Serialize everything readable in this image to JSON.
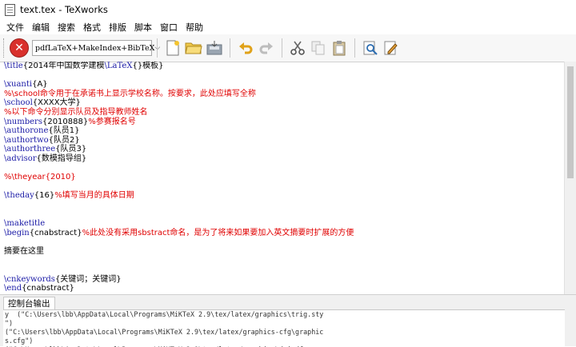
{
  "window": {
    "title": "text.tex - TeXworks"
  },
  "menu": [
    "文件",
    "编辑",
    "搜索",
    "格式",
    "排版",
    "脚本",
    "窗口",
    "帮助"
  ],
  "toolbar": {
    "typeset_engine": "pdfLaTeX+MakeIndex+BibTeX",
    "icons": [
      "stop-typeset-icon",
      "new-file-icon",
      "open-folder-icon",
      "save-icon",
      "undo-icon",
      "redo-icon",
      "cut-icon",
      "copy-icon",
      "paste-icon",
      "search-icon",
      "preferences-icon"
    ]
  },
  "editor": {
    "lines": [
      [
        {
          "t": "\\title",
          "c": "cmd"
        },
        {
          "t": "{2014年中国数学建模",
          "c": "plain"
        },
        {
          "t": "\\LaTeX",
          "c": "cmd"
        },
        {
          "t": "{}模板}",
          "c": "plain"
        }
      ],
      [],
      [
        {
          "t": "\\xuanti",
          "c": "cmd"
        },
        {
          "t": "{A}",
          "c": "plain"
        }
      ],
      [
        {
          "t": "%\\school命令用于在承诺书上显示学校名称。按要求，此处应填写全称",
          "c": "comment"
        }
      ],
      [
        {
          "t": "\\school",
          "c": "cmd"
        },
        {
          "t": "{XXXX大学}",
          "c": "plain"
        }
      ],
      [
        {
          "t": "%以下命令分别显示队员及指导教师姓名",
          "c": "comment"
        }
      ],
      [
        {
          "t": "\\numbers",
          "c": "cmd"
        },
        {
          "t": "{2010888}",
          "c": "plain"
        },
        {
          "t": "%参赛报名号",
          "c": "comment"
        }
      ],
      [
        {
          "t": "\\authorone",
          "c": "cmd"
        },
        {
          "t": "{队员1}",
          "c": "plain"
        }
      ],
      [
        {
          "t": "\\authortwo",
          "c": "cmd"
        },
        {
          "t": "{队员2}",
          "c": "plain"
        }
      ],
      [
        {
          "t": "\\authorthree",
          "c": "cmd"
        },
        {
          "t": "{队员3}",
          "c": "plain"
        }
      ],
      [
        {
          "t": "\\advisor",
          "c": "cmd"
        },
        {
          "t": "{数模指导组}",
          "c": "plain"
        }
      ],
      [],
      [
        {
          "t": "%\\theyear{2010}",
          "c": "comment"
        }
      ],
      [],
      [
        {
          "t": "\\theday",
          "c": "cmd"
        },
        {
          "t": "{16}",
          "c": "plain"
        },
        {
          "t": "%填写当月的具体日期",
          "c": "comment"
        }
      ],
      [],
      [],
      [
        {
          "t": "\\maketitle",
          "c": "cmd"
        }
      ],
      [
        {
          "t": "\\begin",
          "c": "cmd"
        },
        {
          "t": "{cnabstract}",
          "c": "plain"
        },
        {
          "t": "%此处没有采用sbstract命名，是为了将来如果要加入英文摘要时扩展的方便",
          "c": "comment"
        }
      ],
      [],
      [
        {
          "t": "摘要在这里",
          "c": "plain"
        }
      ],
      [],
      [],
      [
        {
          "t": "\\cnkeywords",
          "c": "cmd"
        },
        {
          "t": "{关键词；关键词}",
          "c": "plain"
        }
      ],
      [
        {
          "t": "\\end",
          "c": "cmd"
        },
        {
          "t": "{cnabstract}",
          "c": "plain"
        }
      ]
    ]
  },
  "console": {
    "tab_label": "控制台输出",
    "lines": [
      "y  (\"C:\\Users\\lbb\\AppData\\Local\\Programs\\MiKTeX 2.9\\tex/latex/graphics\\trig.sty",
      "\")",
      "(\"C:\\Users\\lbb\\AppData\\Local\\Programs\\MiKTeX 2.9\\tex/latex/graphics-cfg\\graphic",
      "s.cfg\")",
      "(\"C:\\Users\\lbb\\AppData\\Local\\Programs\\MiKTeX 2.9\\tex/latex/graphics\\dvipdfmx"
    ]
  }
}
